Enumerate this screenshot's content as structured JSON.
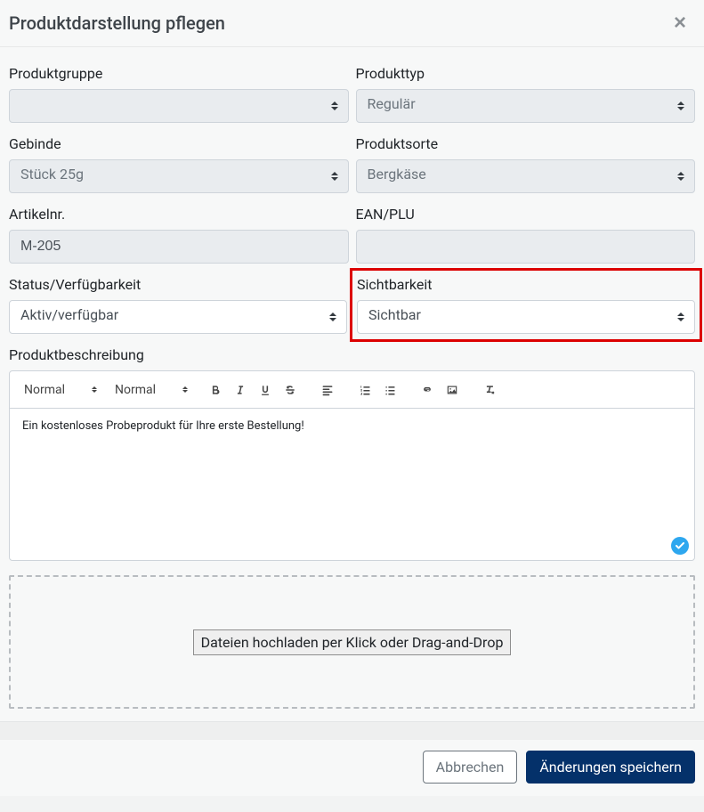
{
  "header": {
    "title": "Produktdarstellung pflegen"
  },
  "fields": {
    "produktgruppe": {
      "label": "Produktgruppe",
      "value": ""
    },
    "produkttyp": {
      "label": "Produkttyp",
      "value": "Regulär"
    },
    "gebinde": {
      "label": "Gebinde",
      "value": "Stück 25g"
    },
    "produktsorte": {
      "label": "Produktsorte",
      "value": "Bergkäse"
    },
    "artikelnr": {
      "label": "Artikelnr.",
      "value": "M-205"
    },
    "eanplu": {
      "label": "EAN/PLU",
      "value": ""
    },
    "status": {
      "label": "Status/Verfügbarkeit",
      "value": "Aktiv/verfügbar"
    },
    "sichtbarkeit": {
      "label": "Sichtbarkeit",
      "value": "Sichtbar"
    },
    "beschreibung": {
      "label": "Produktbeschreibung"
    }
  },
  "editor": {
    "heading_select": "Normal",
    "font_select": "Normal",
    "content": "Ein kostenloses Probeprodukt für Ihre erste Bestellung!"
  },
  "dropzone": {
    "button": "Dateien hochladen per Klick oder Drag-and-Drop"
  },
  "footer": {
    "cancel": "Abbrechen",
    "save": "Änderungen speichern"
  }
}
